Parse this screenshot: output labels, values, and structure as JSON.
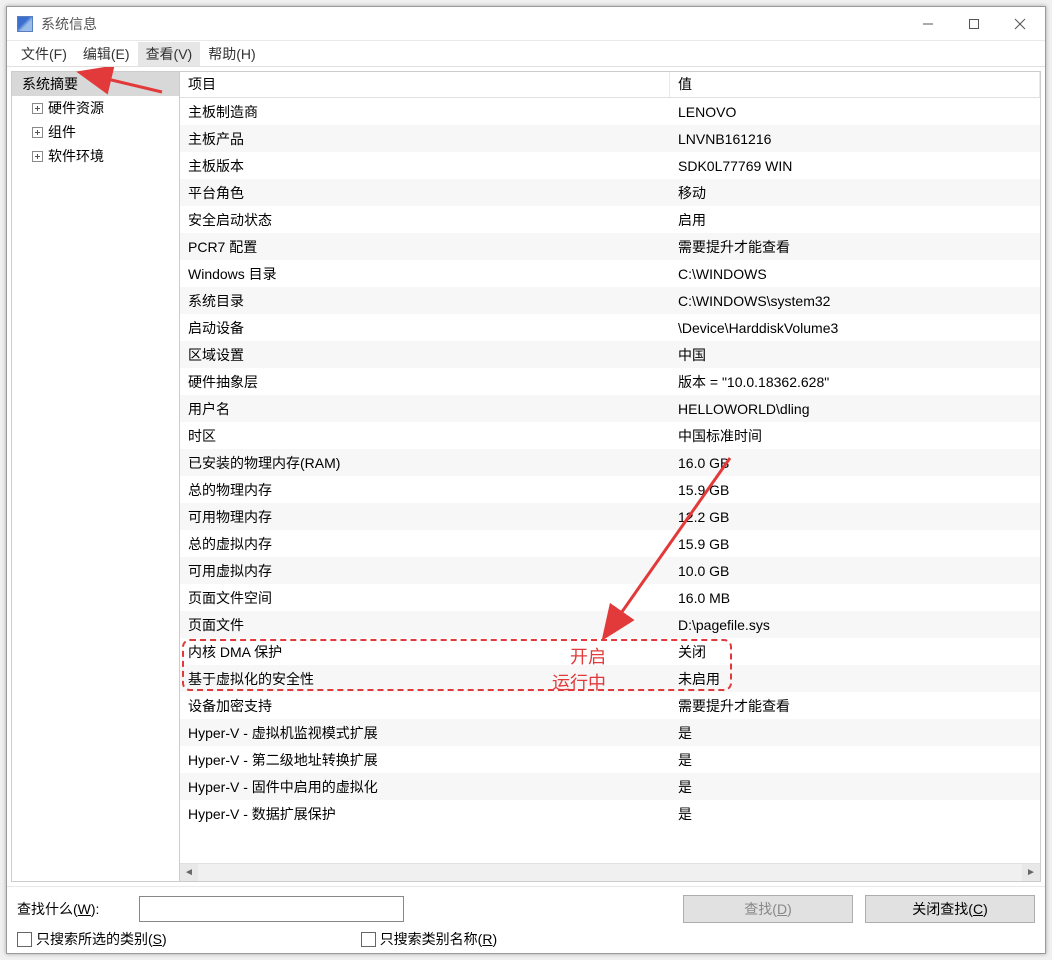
{
  "window": {
    "title": "系统信息"
  },
  "menu": {
    "file": "文件(F)",
    "edit": "编辑(E)",
    "view": "查看(V)",
    "help": "帮助(H)"
  },
  "tree": {
    "summary": "系统摘要",
    "hw": "硬件资源",
    "comp": "组件",
    "sw": "软件环境"
  },
  "columns": {
    "item": "项目",
    "value": "值"
  },
  "rows": [
    {
      "item": "主板制造商",
      "value": "LENOVO"
    },
    {
      "item": "主板产品",
      "value": "LNVNB161216"
    },
    {
      "item": "主板版本",
      "value": "SDK0L77769 WIN"
    },
    {
      "item": "平台角色",
      "value": "移动"
    },
    {
      "item": "安全启动状态",
      "value": "启用"
    },
    {
      "item": "PCR7 配置",
      "value": "需要提升才能查看"
    },
    {
      "item": "Windows 目录",
      "value": "C:\\WINDOWS"
    },
    {
      "item": "系统目录",
      "value": "C:\\WINDOWS\\system32"
    },
    {
      "item": "启动设备",
      "value": "\\Device\\HarddiskVolume3"
    },
    {
      "item": "区域设置",
      "value": "中国"
    },
    {
      "item": "硬件抽象层",
      "value": "版本 = \"10.0.18362.628\""
    },
    {
      "item": "用户名",
      "value": "HELLOWORLD\\dling"
    },
    {
      "item": "时区",
      "value": "中国标准时间"
    },
    {
      "item": "已安装的物理内存(RAM)",
      "value": "16.0 GB"
    },
    {
      "item": "总的物理内存",
      "value": "15.9 GB"
    },
    {
      "item": "可用物理内存",
      "value": "12.2 GB"
    },
    {
      "item": "总的虚拟内存",
      "value": "15.9 GB"
    },
    {
      "item": "可用虚拟内存",
      "value": "10.0 GB"
    },
    {
      "item": "页面文件空间",
      "value": "16.0 MB"
    },
    {
      "item": "页面文件",
      "value": "D:\\pagefile.sys"
    },
    {
      "item": "内核 DMA 保护",
      "value": "关闭"
    },
    {
      "item": "基于虚拟化的安全性",
      "value": "未启用"
    },
    {
      "item": "设备加密支持",
      "value": "需要提升才能查看"
    },
    {
      "item": "Hyper-V - 虚拟机监视模式扩展",
      "value": "是"
    },
    {
      "item": "Hyper-V - 第二级地址转换扩展",
      "value": "是"
    },
    {
      "item": "Hyper-V - 固件中启用的虚拟化",
      "value": "是"
    },
    {
      "item": "Hyper-V - 数据扩展保护",
      "value": "是"
    }
  ],
  "annotations": {
    "line1": "开启",
    "line2": "运行中"
  },
  "search": {
    "label_prefix": "查找什么(",
    "label_u": "W",
    "label_suffix": "):",
    "find_prefix": "查找(",
    "find_u": "D",
    "find_suffix": ")",
    "close_prefix": "关闭查找(",
    "close_u": "C",
    "close_suffix": ")",
    "cat_prefix": "只搜索所选的类别(",
    "cat_u": "S",
    "cat_suffix": ")",
    "name_prefix": "只搜索类别名称(",
    "name_u": "R",
    "name_suffix": ")"
  }
}
